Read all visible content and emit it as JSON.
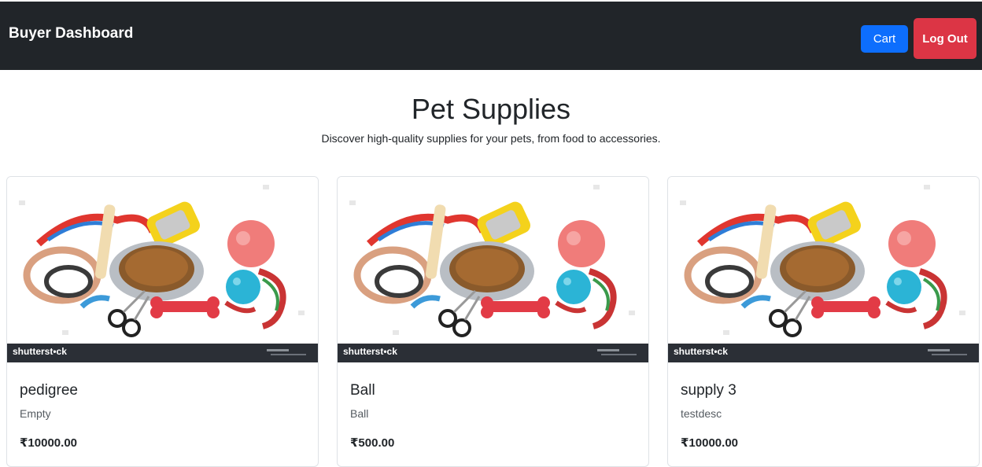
{
  "navbar": {
    "brand": "Buyer Dashboard",
    "cart_label": "Cart",
    "logout_label": "Log Out"
  },
  "hero": {
    "title": "Pet Supplies",
    "subtitle": "Discover high-quality supplies for your pets, from food to accessories."
  },
  "products": [
    {
      "name": "pedigree",
      "description": "Empty",
      "price": "₹10000.00",
      "watermark": "shutterst•ck"
    },
    {
      "name": "Ball",
      "description": "Ball",
      "price": "₹500.00",
      "watermark": "shutterst•ck"
    },
    {
      "name": "supply 3",
      "description": "testdesc",
      "price": "₹10000.00",
      "watermark": "shutterst•ck"
    }
  ],
  "colors": {
    "navbar_bg": "#212529",
    "cart_btn": "#0d6efd",
    "logout_btn": "#dc3545"
  }
}
